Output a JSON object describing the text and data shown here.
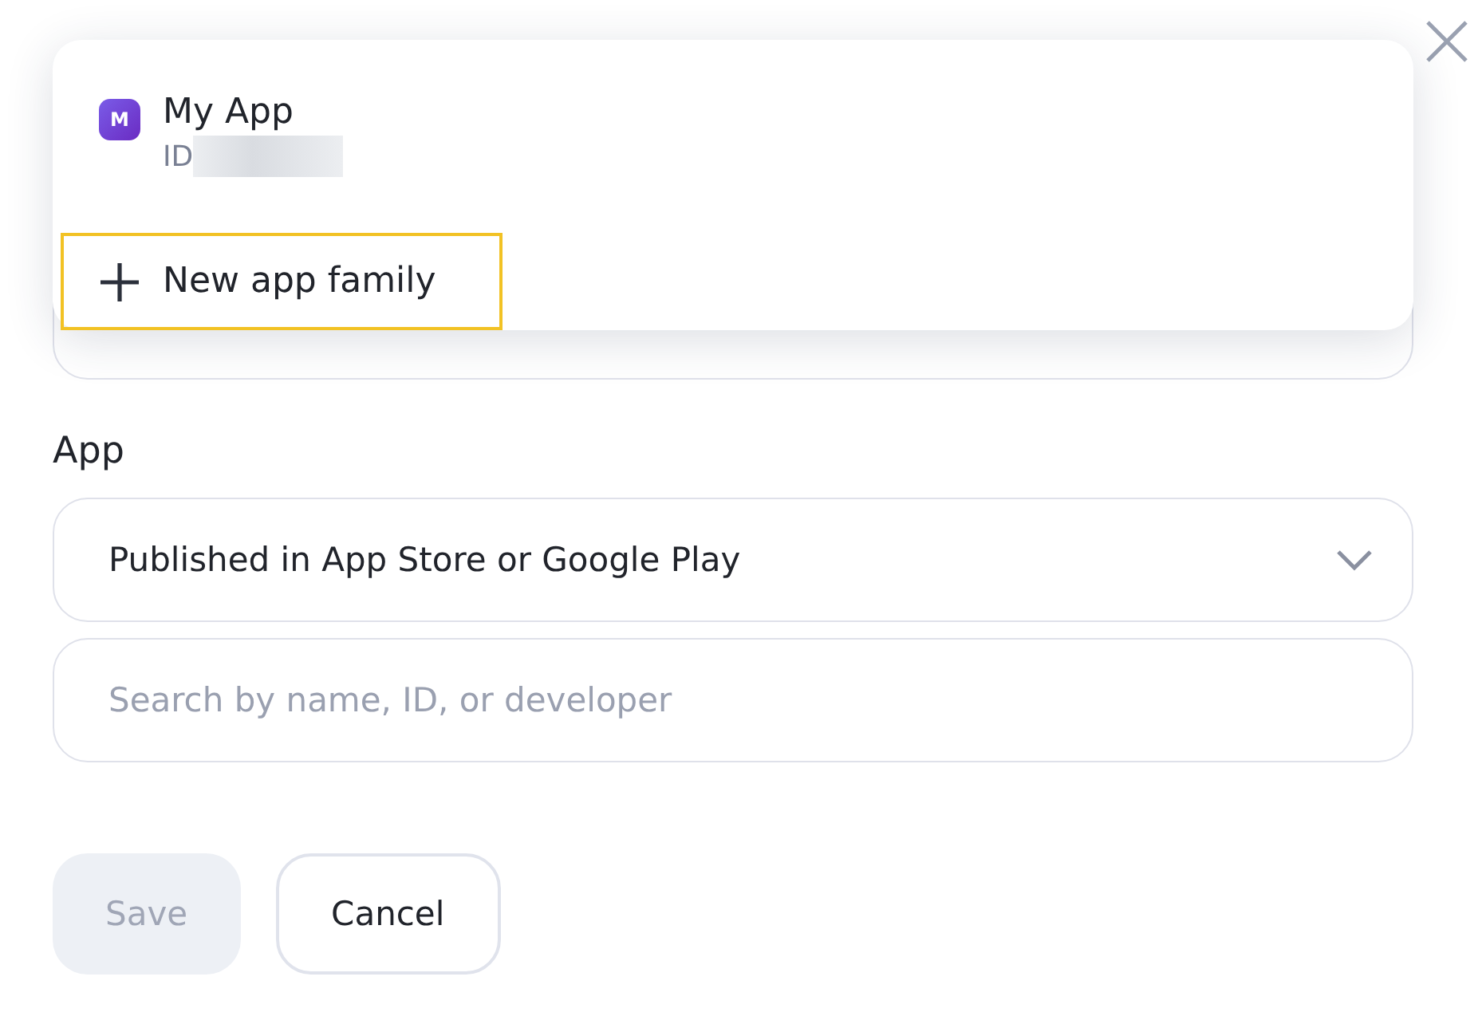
{
  "menu": {
    "items": [
      {
        "kind": "app",
        "badge": "M",
        "title": "My App",
        "subtitle": "ID",
        "focused": false
      },
      {
        "kind": "action",
        "title": "New app family",
        "focused": true
      }
    ]
  },
  "app_field": {
    "label": "App",
    "value": "Published in App Store or Google Play"
  },
  "search": {
    "placeholder": "Search by name, ID, or developer"
  },
  "buttons": [
    {
      "label": "Save",
      "disabled": true
    },
    {
      "label": "Cancel",
      "disabled": false
    }
  ]
}
